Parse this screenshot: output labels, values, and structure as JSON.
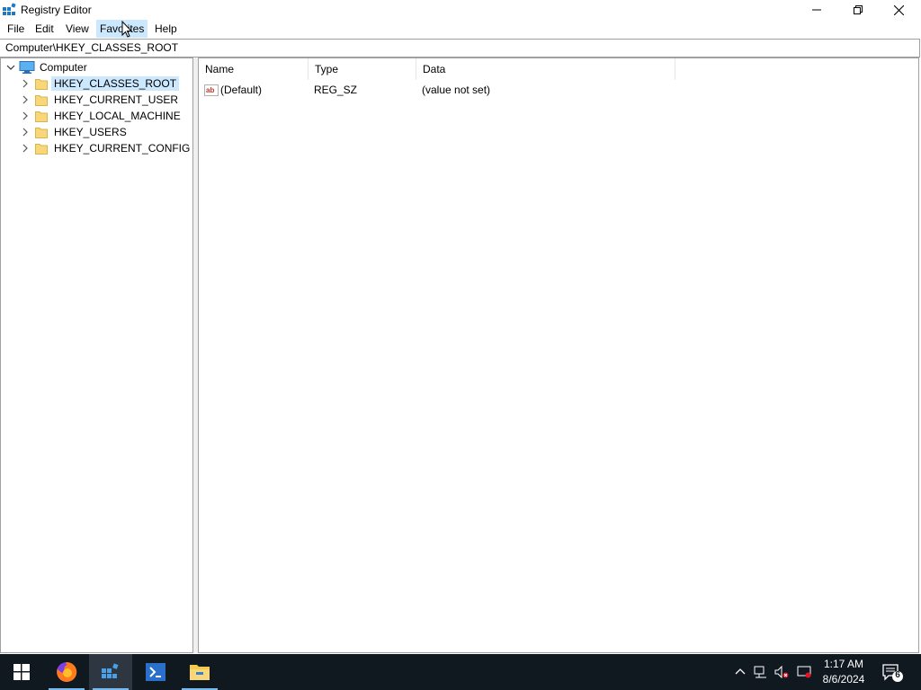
{
  "window": {
    "title": "Registry Editor"
  },
  "menu": {
    "items": [
      {
        "label": "File"
      },
      {
        "label": "Edit"
      },
      {
        "label": "View"
      },
      {
        "label": "Favorites"
      },
      {
        "label": "Help"
      }
    ],
    "hovered": "Favorites"
  },
  "address": {
    "path": "Computer\\HKEY_CLASSES_ROOT"
  },
  "tree": {
    "root": "Computer",
    "keys": [
      {
        "label": "HKEY_CLASSES_ROOT",
        "selected": true
      },
      {
        "label": "HKEY_CURRENT_USER",
        "selected": false
      },
      {
        "label": "HKEY_LOCAL_MACHINE",
        "selected": false
      },
      {
        "label": "HKEY_USERS",
        "selected": false
      },
      {
        "label": "HKEY_CURRENT_CONFIG",
        "selected": false
      }
    ]
  },
  "list": {
    "columns": [
      "Name",
      "Type",
      "Data"
    ],
    "rows": [
      {
        "name": "(Default)",
        "type": "REG_SZ",
        "data": "(value not set)",
        "icon": "string-value-icon"
      }
    ]
  },
  "taskbar": {
    "apps": [
      {
        "name": "start-icon"
      },
      {
        "name": "firefox-icon"
      },
      {
        "name": "registry-editor-icon"
      },
      {
        "name": "powershell-icon"
      },
      {
        "name": "file-explorer-icon"
      }
    ],
    "tray_icons": [
      "chevron-up-icon",
      "network-icon",
      "volume-muted-icon",
      "display-icon"
    ],
    "time": "1:17 AM",
    "date": "8/6/2024",
    "notification_count": "6"
  },
  "colors": {
    "selection": "#cce8ff",
    "taskbar": "#101820",
    "accent": "#76b9ed",
    "folder": "#f7d77a"
  }
}
